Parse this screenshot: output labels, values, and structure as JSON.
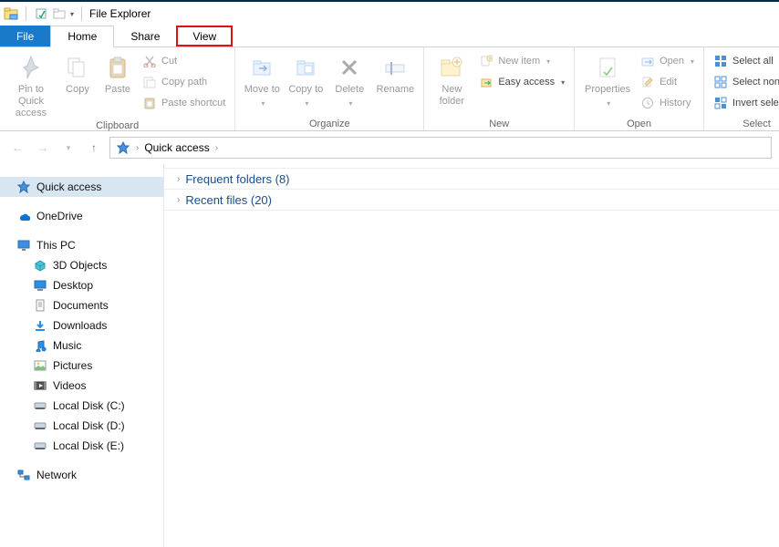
{
  "titlebar": {
    "app_title": "File Explorer"
  },
  "tabs": {
    "file": "File",
    "home": "Home",
    "share": "Share",
    "view": "View"
  },
  "ribbon": {
    "pin": "Pin to Quick access",
    "copy": "Copy",
    "paste": "Paste",
    "cut": "Cut",
    "copy_path": "Copy path",
    "paste_shortcut": "Paste shortcut",
    "group_clipboard": "Clipboard",
    "move_to": "Move to",
    "copy_to": "Copy to",
    "delete": "Delete",
    "rename": "Rename",
    "group_organize": "Organize",
    "new_folder": "New folder",
    "new_item": "New item",
    "easy_access": "Easy access",
    "group_new": "New",
    "properties": "Properties",
    "open": "Open",
    "edit": "Edit",
    "history": "History",
    "group_open": "Open",
    "select_all": "Select all",
    "select_none": "Select none",
    "invert_selection": "Invert selection",
    "group_select": "Select"
  },
  "address": {
    "root": "Quick access"
  },
  "tree": {
    "quick_access": "Quick access",
    "onedrive": "OneDrive",
    "this_pc": "This PC",
    "objects3d": "3D Objects",
    "desktop": "Desktop",
    "documents": "Documents",
    "downloads": "Downloads",
    "music": "Music",
    "pictures": "Pictures",
    "videos": "Videos",
    "disk_c": "Local Disk (C:)",
    "disk_d": "Local Disk (D:)",
    "disk_e": "Local Disk (E:)",
    "network": "Network"
  },
  "content": {
    "frequent": "Frequent folders (8)",
    "recent": "Recent files (20)"
  }
}
